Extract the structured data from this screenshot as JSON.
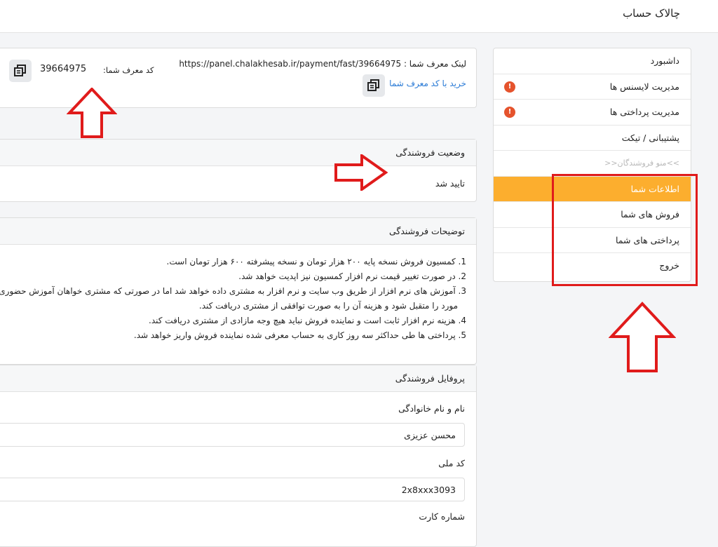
{
  "header": {
    "brand": "چالاک حساب"
  },
  "sidebar": {
    "items": [
      {
        "label": "داشبورد"
      },
      {
        "label": "مدیریت لایسنس ها",
        "badge": "!"
      },
      {
        "label": "مدیریت پرداختی ها",
        "badge": "!"
      },
      {
        "label": "پشتیبانی / تیکت"
      },
      {
        "label": ">>منو فروشندگان<<"
      },
      {
        "label": "اطلاعات شما"
      },
      {
        "label": "فروش های شما"
      },
      {
        "label": "پرداختی های شما"
      },
      {
        "label": "خروج"
      }
    ]
  },
  "referral": {
    "link_text": "لینک معرف شما : https://panel.chalakhesab.ir/payment/fast/39664975",
    "buy_text": "خرید با کد معرف شما",
    "code_label": "کد معرف شما:",
    "code_value": "39664975"
  },
  "status_card": {
    "title": "وضعیت فروشندگی",
    "value": "تایید شد"
  },
  "description_card": {
    "title": "توضیحات فروشندگی",
    "items": [
      "1. کمسیون فروش نسخه پایه ۲۰۰ هزار تومان و نسخه پیشرفته ۶۰۰ هزار تومان است.",
      "2. در صورت تغییر قیمت نرم افزار کمسیون نیز اپدیت خواهد شد.",
      "3. آموزش های نرم افزار از طریق وب سایت و نرم افزار به مشتری داده خواهد شد اما در صورتی که مشتری خواهان آموزش حضوری",
      "مورد را متقبل شود و هزینه آن را به صورت توافقی از مشتری دریافت کند.",
      "4. هزینه نرم افزار ثابت است و نماینده فروش نباید هیچ وجه مازادی از مشتری دریافت کند.",
      "5. پرداختی ها طی حداکثر سه روز کاری به حساب معرفی شده نماینده فروش واریز خواهد شد."
    ]
  },
  "profile_card": {
    "title": "پروفایل فروشندگی",
    "name_label": "نام و نام خانوادگی",
    "name_value": "محسن عزیزی",
    "national_id_label": "کد ملی",
    "national_id_value": "2x8xxx3093",
    "next_label": "شماره کارت"
  },
  "colors": {
    "accent": "#fcae2e",
    "badge": "#e5532d",
    "annotation": "#e01b1b",
    "link": "#2b7bd6"
  }
}
